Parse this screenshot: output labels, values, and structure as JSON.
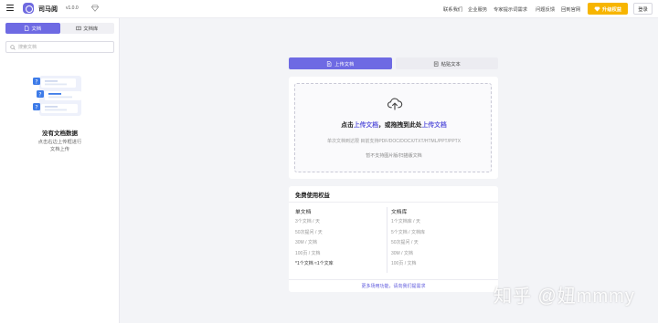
{
  "app": {
    "name": "司马阅",
    "version": "v1.0.0"
  },
  "header": {
    "links": [
      "联系我们",
      "企业服务",
      "专家提示词需求",
      "问题反馈",
      "回到官网"
    ],
    "upgrade_label": "升级权益",
    "login_label": "登录"
  },
  "sidebar": {
    "tabs": [
      {
        "label": "文档"
      },
      {
        "label": "文档库"
      }
    ],
    "search_placeholder": "搜索文档",
    "empty_title": "没有文档数据",
    "empty_desc_line1": "点击右边上传框进行",
    "empty_desc_line2": "文档上传"
  },
  "main": {
    "tabs": [
      {
        "label": "上传文档"
      },
      {
        "label": "粘贴文本"
      }
    ],
    "upload": {
      "title_prefix": "点击",
      "title_link1": "上传文档",
      "title_mid": "，或拖拽到此处",
      "title_link2": "上传文档",
      "formats": "单次文档到达限 目前支持PDF/DOC/DOCX/TXT/HTML/PPT/PPTX",
      "note": "暂不支持图片版/扫描版文档"
    },
    "rights": {
      "title": "免费使用权益",
      "single": {
        "title": "单文档",
        "items": [
          "3个文档 / 天",
          "50次提问 / 天",
          "30M / 文档",
          "100页 / 文档",
          "*1个文档 ≈1个文库"
        ]
      },
      "library": {
        "title": "文档库",
        "items": [
          "1个文档库 / 天",
          "5个文档 / 文档库",
          "50次提问 / 天",
          "30M / 文档",
          "100页 / 文档"
        ]
      },
      "footer": "更多场用功能，请向我们提需求"
    }
  },
  "watermark": "知乎 @妞mmmy",
  "colors": {
    "accent": "#6e6ae3",
    "upgrade": "#f7b500",
    "background": "#f3f4f7"
  }
}
